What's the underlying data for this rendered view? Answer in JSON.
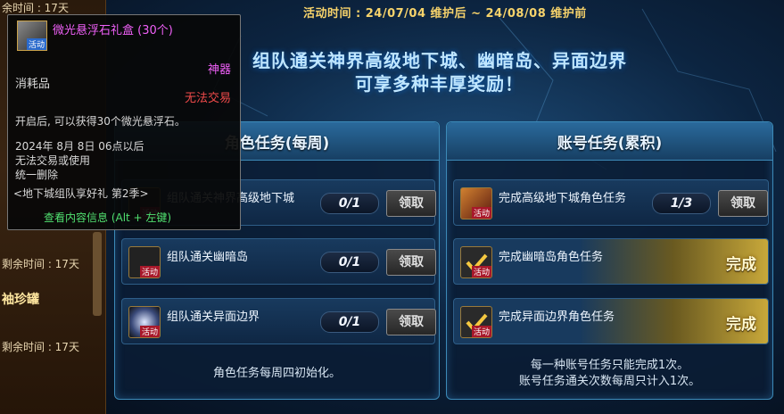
{
  "header": {
    "event_time": "活动时间 : 24/07/04 维护后 ~ 24/08/08 维护前",
    "headline_line1": "组队通关神界高级地下城、幽暗岛、异面边界",
    "headline_line2": "可享多种丰厚奖励！"
  },
  "sidebar": {
    "top_text": "余时间 : 17天",
    "remaining_1": "剩余时间 : 17天",
    "item_name": "袖珍罐",
    "remaining_2": "剩余时间 : 17天"
  },
  "left_panel": {
    "title": "角色任务(每周)",
    "tasks": [
      {
        "label": "组队通关神界高级地下城",
        "progress": "0/1",
        "button": "领取"
      },
      {
        "label": "组队通关幽暗岛",
        "progress": "0/1",
        "button": "领取"
      },
      {
        "label": "组队通关异面边界",
        "progress": "0/1",
        "button": "领取"
      }
    ],
    "footer": "角色任务每周四初始化。"
  },
  "right_panel": {
    "title": "账号任务(累积)",
    "tasks": [
      {
        "label": "完成高级地下城角色任务",
        "progress": "1/3",
        "button": "领取"
      },
      {
        "label": "完成幽暗岛角色任务",
        "status": "完成"
      },
      {
        "label": "完成异面边界角色任务",
        "status": "完成"
      }
    ],
    "footer_line1": "每一种账号任务只能完成1次。",
    "footer_line2": "账号任务通关次数每周只计入1次。"
  },
  "icon_tag": "活动",
  "tooltip": {
    "name": "微光悬浮石礼盒 (30个)",
    "rarity": "神器",
    "type": "消耗品",
    "trade": "无法交易",
    "desc": "开启后, 可以获得30个微光悬浮石。",
    "expire_date": "2024年 8月 8日 06点以后",
    "expire_note1": "无法交易或使用",
    "expire_note2": "统一删除",
    "source": "<地下城组队享好礼 第2季>",
    "view_hint": "查看内容信息 (Alt + 左键)"
  },
  "colors": {
    "accent_gold": "#f7d36b",
    "epic_purple": "#f060f8",
    "warning_red": "#f04a4a",
    "hint_green": "#50e070"
  }
}
